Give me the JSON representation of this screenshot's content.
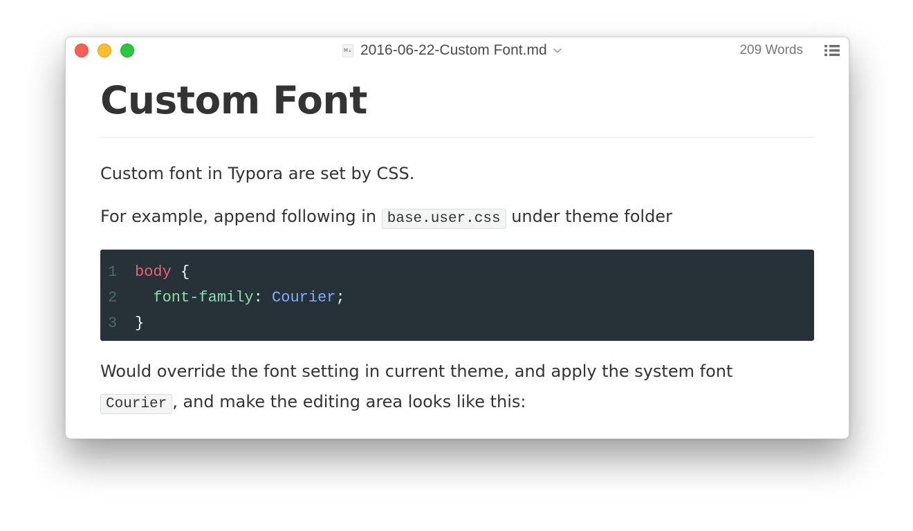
{
  "window": {
    "title": "2016-06-22-Custom Font.md",
    "doc_icon_label": "M⇣",
    "word_count": "209 Words"
  },
  "colors": {
    "close": "#fd5f57",
    "minimize": "#febc2e",
    "zoom": "#28c840",
    "code_background": "#263238",
    "code_selector": "#ef5b75",
    "code_property": "#89ddb0",
    "code_value": "#82aaff"
  },
  "icons": {
    "title_dropdown": "chevron-down-icon",
    "outline": "list-icon",
    "document": "markdown-file-icon"
  },
  "document": {
    "heading": "Custom Font",
    "p1": "Custom font in Typora are set by CSS.",
    "p2_before": "For example, append following in ",
    "p2_code": "base.user.css",
    "p2_after": " under theme folder",
    "code": {
      "lines": [
        {
          "num": "1",
          "selector": "body",
          "brace_open": " {"
        },
        {
          "num": "2",
          "indent": "  ",
          "property": "font-family",
          "colon": ": ",
          "value": "Courier",
          "semicolon": ";"
        },
        {
          "num": "3",
          "brace_close": "}"
        }
      ]
    },
    "p3": "Would override the font setting in current theme, and apply the system font",
    "p4_code": "Courier",
    "p4_after": ", and make the editing area looks like this:"
  }
}
